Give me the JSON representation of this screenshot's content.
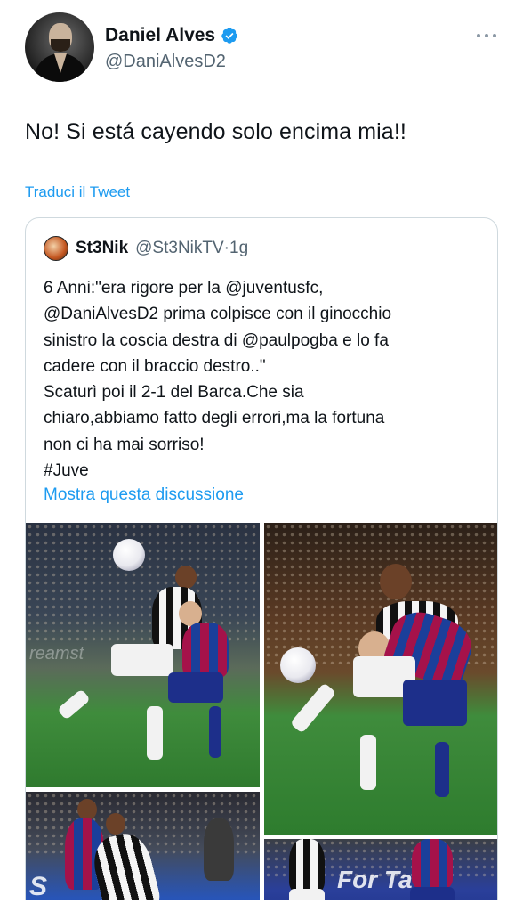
{
  "tweet": {
    "author_name": "Daniel Alves",
    "author_handle": "@DaniAlvesD2",
    "text": "No! Si está cayendo solo encima mia!!",
    "translate_label": "Traduci il Tweet"
  },
  "quoted_tweet": {
    "author_name": "St3Nik",
    "author_handle": "@St3NikTV",
    "separator": "·",
    "time": "1g",
    "lines": [
      "6 Anni:\"era rigore per la @juventusfc,",
      "@DaniAlvesD2 prima colpisce con il ginocchio",
      "sinistro la coscia destra di @paulpogba e lo fa",
      "cadere con il braccio destro..\"",
      "Scaturì poi il 2-1 del Barca.Che sia",
      "chiaro,abbiamo fatto degli errori,ma la fortuna",
      "non ci ha mai sorriso!",
      "#Juve"
    ],
    "show_thread_label": "Mostra questa discussione",
    "media_overlay": {
      "watermark": "reamst",
      "banner_left": "S",
      "banner_right": "For Ta"
    }
  },
  "colors": {
    "link": "#1d9bf0",
    "secondary_text": "#536471",
    "verified": "#1d9bf0",
    "border": "#cfd9de"
  },
  "icons": {
    "verified": "verified-badge-icon",
    "more": "more-options-icon"
  }
}
